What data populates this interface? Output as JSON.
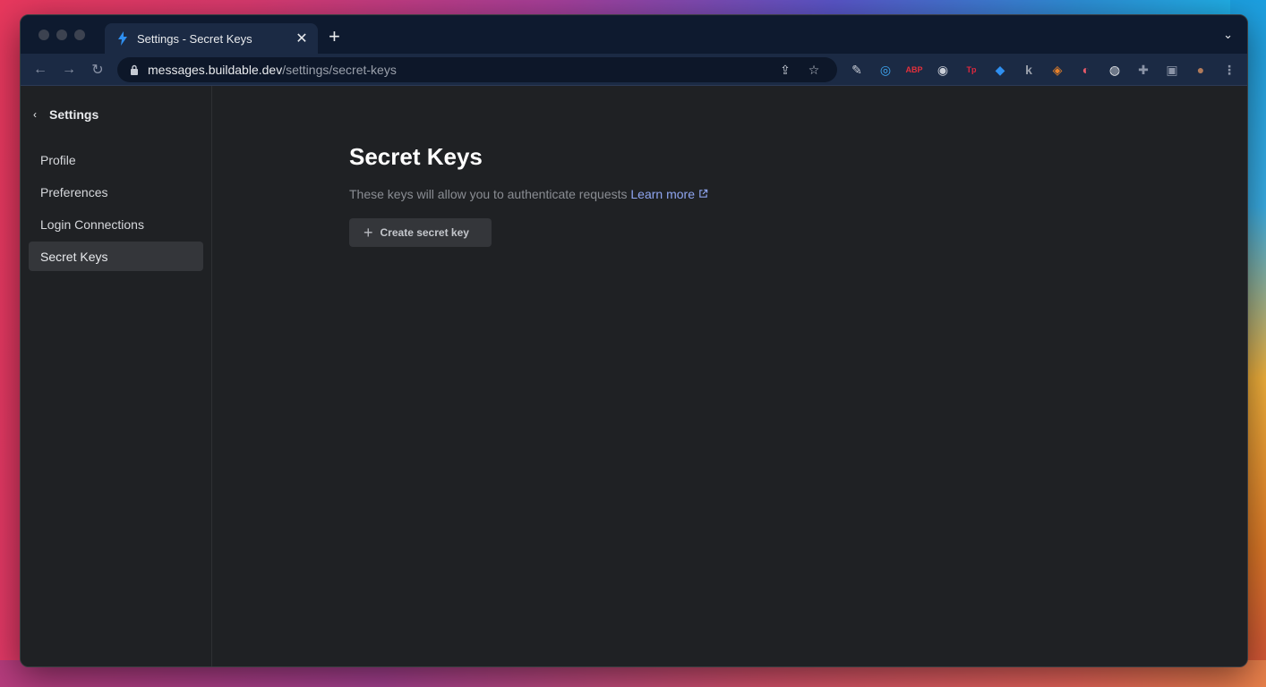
{
  "browser": {
    "tab_title": "Settings - Secret Keys",
    "tab_close": "✕",
    "new_tab": "+",
    "tab_menu": "⌄",
    "url_host": "messages.buildable.dev",
    "url_path": "/settings/secret-keys",
    "nav": {
      "back": "←",
      "forward": "→",
      "reload": "↻"
    },
    "extensions": [
      {
        "name": "pen-extension-icon",
        "glyph": "✎",
        "color": "#c9cdd6"
      },
      {
        "name": "circle-extension-icon",
        "glyph": "◎",
        "color": "#3fa9f5"
      },
      {
        "name": "adblock-plus-icon",
        "glyph": "ABP",
        "color": "#e3303b"
      },
      {
        "name": "owl-extension-icon",
        "glyph": "◉",
        "color": "#c9cdd6"
      },
      {
        "name": "tp-extension-icon",
        "glyph": "Tp",
        "color": "#e0283e"
      },
      {
        "name": "drop-extension-icon",
        "glyph": "◆",
        "color": "#2f8ff0"
      },
      {
        "name": "k-extension-icon",
        "glyph": "k",
        "color": "#9aa0ab"
      },
      {
        "name": "metamask-fox-icon",
        "glyph": "◈",
        "color": "#e8822a"
      },
      {
        "name": "shield-extension-icon",
        "glyph": "◐",
        "color": "#e85a6a"
      },
      {
        "name": "lock-extension-icon",
        "glyph": "◍",
        "color": "#e8eaed"
      },
      {
        "name": "puzzle-extensions-icon",
        "glyph": "✚",
        "color": "#8a93a6"
      },
      {
        "name": "sidepanel-icon",
        "glyph": "▣",
        "color": "#8a93a6"
      },
      {
        "name": "profile-avatar-icon",
        "glyph": "●",
        "color": "#b07a5a"
      },
      {
        "name": "kebab-menu-icon",
        "glyph": "⋮",
        "color": "#8a93a6"
      }
    ]
  },
  "sidebar": {
    "back_label": "Settings",
    "items": [
      {
        "label": "Profile"
      },
      {
        "label": "Preferences"
      },
      {
        "label": "Login Connections"
      },
      {
        "label": "Secret Keys",
        "active": true
      }
    ]
  },
  "main": {
    "title": "Secret Keys",
    "description": "These keys will allow you to authenticate requests",
    "learn_more": "Learn more",
    "create_button": "Create secret key"
  }
}
